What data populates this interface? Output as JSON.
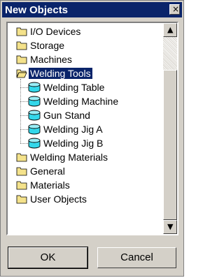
{
  "window": {
    "title": "New Objects",
    "close_glyph": "×"
  },
  "tree": {
    "items": [
      {
        "label": "I/O Devices",
        "icon": "folder-closed-icon",
        "level": 0,
        "selected": false
      },
      {
        "label": "Storage",
        "icon": "folder-closed-icon",
        "level": 0,
        "selected": false
      },
      {
        "label": "Machines",
        "icon": "folder-closed-icon",
        "level": 0,
        "selected": false
      },
      {
        "label": "Welding Tools",
        "icon": "folder-open-icon",
        "level": 0,
        "selected": true
      },
      {
        "label": "Welding Table",
        "icon": "cylinder-icon",
        "level": 1,
        "selected": false
      },
      {
        "label": "Welding Machine",
        "icon": "cylinder-icon",
        "level": 1,
        "selected": false
      },
      {
        "label": "Gun Stand",
        "icon": "cylinder-icon",
        "level": 1,
        "selected": false
      },
      {
        "label": "Welding Jig A",
        "icon": "cylinder-icon",
        "level": 1,
        "selected": false
      },
      {
        "label": "Welding Jig B",
        "icon": "cylinder-icon",
        "level": 1,
        "selected": false
      },
      {
        "label": "Welding Materials",
        "icon": "folder-closed-icon",
        "level": 0,
        "selected": false
      },
      {
        "label": "General",
        "icon": "folder-closed-icon",
        "level": 0,
        "selected": false
      },
      {
        "label": "Materials",
        "icon": "folder-closed-icon",
        "level": 0,
        "selected": false
      },
      {
        "label": "User Objects",
        "icon": "folder-closed-icon",
        "level": 0,
        "selected": false
      }
    ]
  },
  "scrollbar": {
    "up_glyph": "▲",
    "down_glyph": "▼",
    "thumb_start_fraction": 0.18,
    "thumb_size_fraction": 0.82
  },
  "buttons": {
    "ok_label": "OK",
    "cancel_label": "Cancel"
  },
  "colors": {
    "title_bar": "#0a246a",
    "selection": "#0a246a",
    "folder": "#f4e28b",
    "cylinder": "#33d7ea"
  }
}
